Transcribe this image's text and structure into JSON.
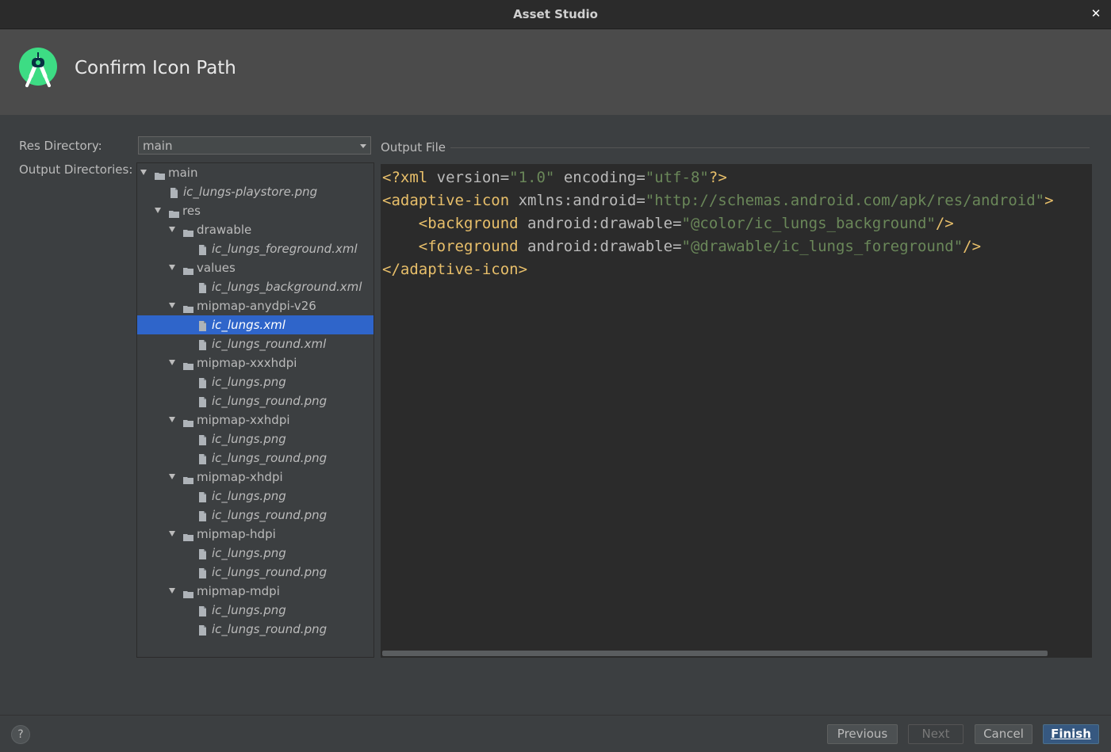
{
  "window": {
    "title": "Asset Studio",
    "close_glyph": "✕"
  },
  "header": {
    "heading": "Confirm Icon Path",
    "logo_icon": "android-studio-icon"
  },
  "form": {
    "res_directory_label": "Res Directory:",
    "res_directory_value": "main",
    "output_directories_label": "Output Directories:"
  },
  "tree": {
    "items": [
      {
        "label": "main",
        "type": "folder",
        "level": 0,
        "expanded": true,
        "selected": false
      },
      {
        "label": "ic_lungs-playstore.png",
        "type": "file",
        "level": 1,
        "selected": false
      },
      {
        "label": "res",
        "type": "folder",
        "level": 1,
        "expanded": true,
        "selected": false
      },
      {
        "label": "drawable",
        "type": "folder",
        "level": 2,
        "expanded": true,
        "selected": false
      },
      {
        "label": "ic_lungs_foreground.xml",
        "type": "file",
        "level": 3,
        "selected": false
      },
      {
        "label": "values",
        "type": "folder",
        "level": 2,
        "expanded": true,
        "selected": false
      },
      {
        "label": "ic_lungs_background.xml",
        "type": "file",
        "level": 3,
        "selected": false
      },
      {
        "label": "mipmap-anydpi-v26",
        "type": "folder",
        "level": 2,
        "expanded": true,
        "selected": false
      },
      {
        "label": "ic_lungs.xml",
        "type": "file",
        "level": 3,
        "selected": true
      },
      {
        "label": "ic_lungs_round.xml",
        "type": "file",
        "level": 3,
        "selected": false
      },
      {
        "label": "mipmap-xxxhdpi",
        "type": "folder",
        "level": 2,
        "expanded": true,
        "selected": false
      },
      {
        "label": "ic_lungs.png",
        "type": "file",
        "level": 3,
        "selected": false
      },
      {
        "label": "ic_lungs_round.png",
        "type": "file",
        "level": 3,
        "selected": false
      },
      {
        "label": "mipmap-xxhdpi",
        "type": "folder",
        "level": 2,
        "expanded": true,
        "selected": false
      },
      {
        "label": "ic_lungs.png",
        "type": "file",
        "level": 3,
        "selected": false
      },
      {
        "label": "ic_lungs_round.png",
        "type": "file",
        "level": 3,
        "selected": false
      },
      {
        "label": "mipmap-xhdpi",
        "type": "folder",
        "level": 2,
        "expanded": true,
        "selected": false
      },
      {
        "label": "ic_lungs.png",
        "type": "file",
        "level": 3,
        "selected": false
      },
      {
        "label": "ic_lungs_round.png",
        "type": "file",
        "level": 3,
        "selected": false
      },
      {
        "label": "mipmap-hdpi",
        "type": "folder",
        "level": 2,
        "expanded": true,
        "selected": false
      },
      {
        "label": "ic_lungs.png",
        "type": "file",
        "level": 3,
        "selected": false
      },
      {
        "label": "ic_lungs_round.png",
        "type": "file",
        "level": 3,
        "selected": false
      },
      {
        "label": "mipmap-mdpi",
        "type": "folder",
        "level": 2,
        "expanded": true,
        "selected": false
      },
      {
        "label": "ic_lungs.png",
        "type": "file",
        "level": 3,
        "selected": false
      },
      {
        "label": "ic_lungs_round.png",
        "type": "file",
        "level": 3,
        "selected": false
      }
    ]
  },
  "output_file": {
    "label": "Output File",
    "code_lines": [
      [
        {
          "t": "<?xml ",
          "c": "tag"
        },
        {
          "t": "version",
          "c": "attr"
        },
        {
          "t": "=",
          "c": "attr"
        },
        {
          "t": "\"1.0\"",
          "c": "str"
        },
        {
          "t": " ",
          "c": "attr"
        },
        {
          "t": "encoding",
          "c": "attr"
        },
        {
          "t": "=",
          "c": "attr"
        },
        {
          "t": "\"utf-8\"",
          "c": "str"
        },
        {
          "t": "?>",
          "c": "tag"
        }
      ],
      [
        {
          "t": "<adaptive-icon ",
          "c": "tag"
        },
        {
          "t": "xmlns:android",
          "c": "attr"
        },
        {
          "t": "=",
          "c": "attr"
        },
        {
          "t": "\"http://schemas.android.com/apk/res/android\"",
          "c": "str"
        },
        {
          "t": ">",
          "c": "tag"
        }
      ],
      [
        {
          "t": "    ",
          "c": "attr"
        },
        {
          "t": "<background ",
          "c": "tag"
        },
        {
          "t": "android:drawable",
          "c": "attr"
        },
        {
          "t": "=",
          "c": "attr"
        },
        {
          "t": "\"@color/ic_lungs_background\"",
          "c": "str"
        },
        {
          "t": "/>",
          "c": "tag"
        }
      ],
      [
        {
          "t": "    ",
          "c": "attr"
        },
        {
          "t": "<foreground ",
          "c": "tag"
        },
        {
          "t": "android:drawable",
          "c": "attr"
        },
        {
          "t": "=",
          "c": "attr"
        },
        {
          "t": "\"@drawable/ic_lungs_foreground\"",
          "c": "str"
        },
        {
          "t": "/>",
          "c": "tag"
        }
      ],
      [
        {
          "t": "</adaptive-icon>",
          "c": "tag"
        }
      ]
    ]
  },
  "footer": {
    "help_label": "?",
    "previous_label": "Previous",
    "next_label": "Next",
    "cancel_label": "Cancel",
    "finish_label": "Finish"
  },
  "colors": {
    "selection": "#2f65ca",
    "tag": "#e8bf6a",
    "string": "#6a8759",
    "attribute": "#bababa",
    "primary_button": "#365880",
    "logo_green": "#3ddc84"
  }
}
